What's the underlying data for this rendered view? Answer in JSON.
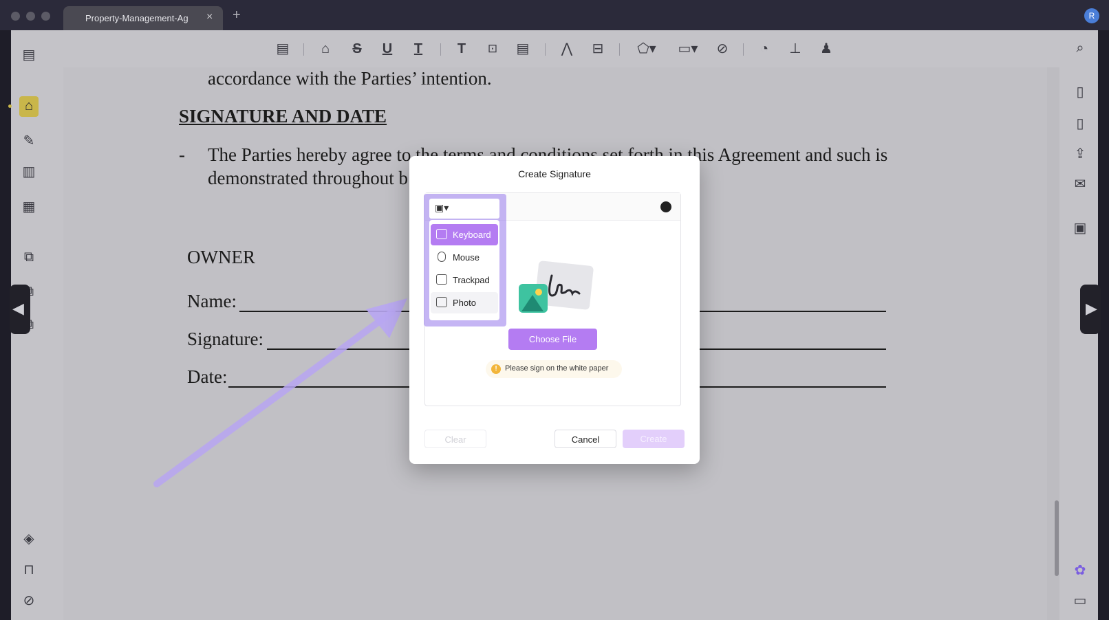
{
  "window": {
    "tab_title": "Property-Management-Ag",
    "tab_close": "×",
    "tab_add": "+",
    "avatar_initial": "R"
  },
  "document": {
    "line_intention": "accordance with the Parties’ intention.",
    "heading": "SIGNATURE AND DATE",
    "bullet": "-",
    "agree_line1": "The Parties hereby agree to the terms and conditions set forth in this Agreement and such is",
    "agree_line2": "demonstrated throughout b",
    "owner": "OWNER",
    "name_label": "Name:",
    "signature_label": "Signature:",
    "date_label": "Date:"
  },
  "dialog": {
    "title": "Create Signature",
    "choose_file": "Choose File",
    "hint": "Please sign on the white paper",
    "hint_icon": "!",
    "clear": "Clear",
    "cancel": "Cancel",
    "create": "Create"
  },
  "input_menu": {
    "selected_icon": "photo-icon",
    "items": [
      {
        "label": "Keyboard",
        "icon": "keyboard-icon"
      },
      {
        "label": "Mouse",
        "icon": "mouse-icon"
      },
      {
        "label": "Trackpad",
        "icon": "trackpad-icon"
      },
      {
        "label": "Photo",
        "icon": "photo-icon"
      }
    ]
  },
  "colors": {
    "accent": "#b47cf2",
    "accent_disabled": "#e3cffb",
    "arrow": "#b8a6f2"
  }
}
